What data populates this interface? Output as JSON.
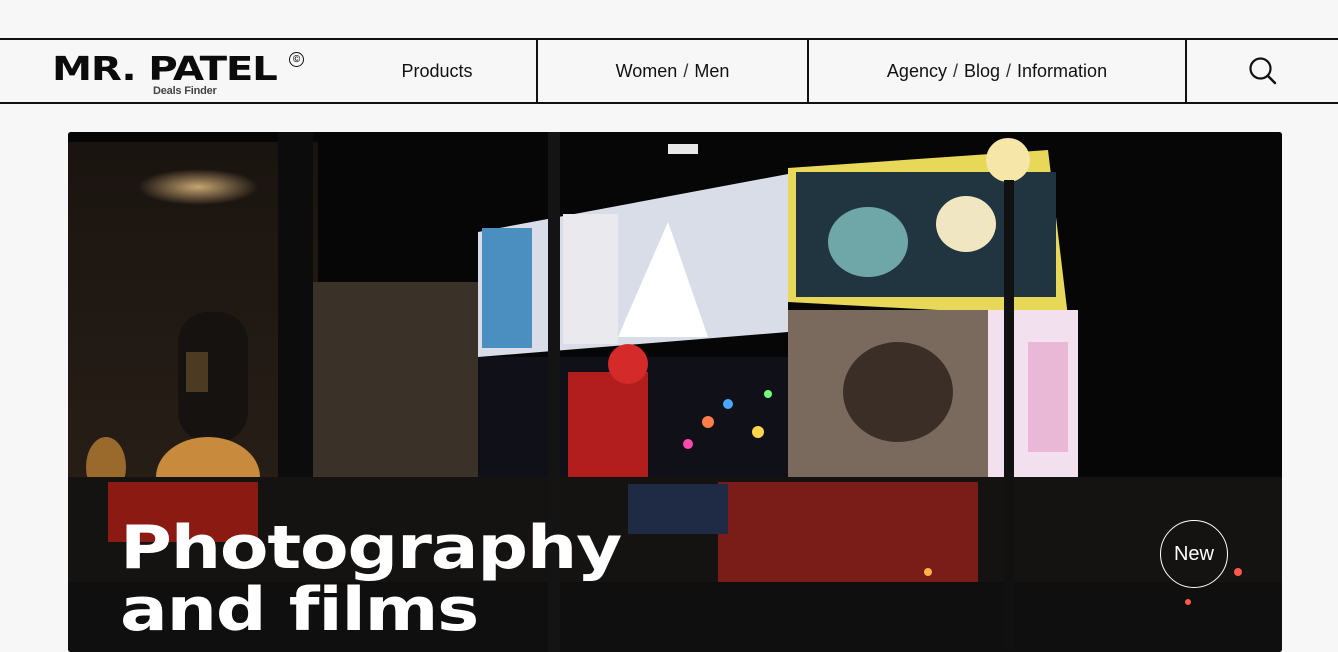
{
  "brand": {
    "name": "MR. PATEL",
    "copyright": "©",
    "tagline": "Deals Finder"
  },
  "nav": {
    "products": "Products",
    "gender": [
      "Women",
      "/",
      "Men"
    ],
    "info": [
      "Agency",
      "/",
      "Blog",
      "/",
      "Information"
    ],
    "search_icon": "search-icon"
  },
  "hero": {
    "title_line1": "Photography",
    "title_line2": "and films",
    "badge": "New"
  }
}
